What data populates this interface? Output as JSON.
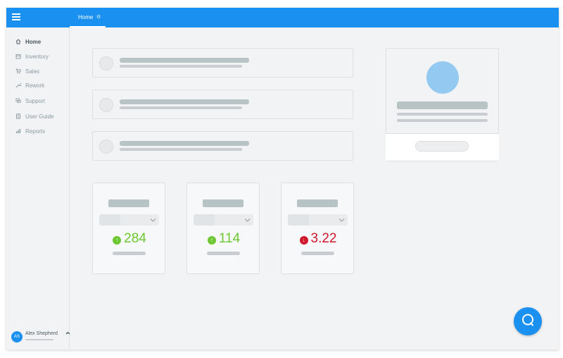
{
  "topbar": {
    "menu_icon": "hamburger-menu-icon",
    "tab": {
      "label": "Home",
      "icon": "gear-icon",
      "icon_glyph": "⚙"
    },
    "color": "#1a91f0"
  },
  "sidebar": {
    "items": [
      {
        "label": "Home",
        "icon": "home-icon",
        "active": true
      },
      {
        "label": "Inventory",
        "icon": "inventory-icon",
        "active": false
      },
      {
        "label": "Sales",
        "icon": "cart-icon",
        "active": false
      },
      {
        "label": "Rework",
        "icon": "wrench-icon",
        "active": false
      },
      {
        "label": "Support",
        "icon": "support-icon",
        "active": false
      },
      {
        "label": "User Guide",
        "icon": "guide-icon",
        "active": false
      },
      {
        "label": "Reports",
        "icon": "reports-icon",
        "active": false
      }
    ],
    "user": {
      "initials": "AS",
      "name": "Alex Shepherd",
      "caret": "^"
    }
  },
  "stats": [
    {
      "value": "284",
      "trend": "up",
      "arrow": "↑",
      "color": "#6cc733"
    },
    {
      "value": "114",
      "trend": "up",
      "arrow": "↑",
      "color": "#6cc733"
    },
    {
      "value": "3.22",
      "trend": "down",
      "arrow": "↓",
      "color": "#d0182b"
    }
  ],
  "chat": {
    "icon": "chat-bubble-icon"
  },
  "colors": {
    "accent": "#1a91f0",
    "up": "#6cc733",
    "down": "#d0182b",
    "avatar_placeholder": "#94c9f2"
  }
}
